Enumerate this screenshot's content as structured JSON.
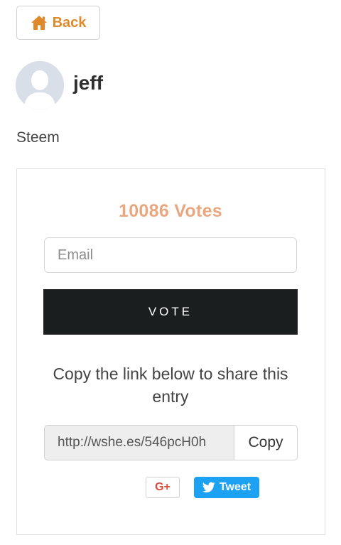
{
  "header": {
    "back_label": "Back",
    "back_icon": "home-icon"
  },
  "profile": {
    "username": "jeff",
    "entry_name": "Steem",
    "avatar_icon": "default-avatar-icon"
  },
  "vote_card": {
    "votes_text": "10086 Votes",
    "email_placeholder": "Email",
    "email_value": "",
    "vote_label": "VOTE",
    "share_text": "Copy the link below to share this entry",
    "share_link": "http://wshe.es/546pcH0h",
    "copy_label": "Copy"
  },
  "social": {
    "gplus_label": "G+",
    "tweet_label": "Tweet",
    "tweet_icon": "twitter-bird-icon"
  },
  "colors": {
    "accent_orange": "#e0892b",
    "votes_color": "#eaa77f",
    "vote_button_bg": "#1b1e1f",
    "twitter_blue": "#1da1f2",
    "gplus_red": "#dd4b39"
  }
}
